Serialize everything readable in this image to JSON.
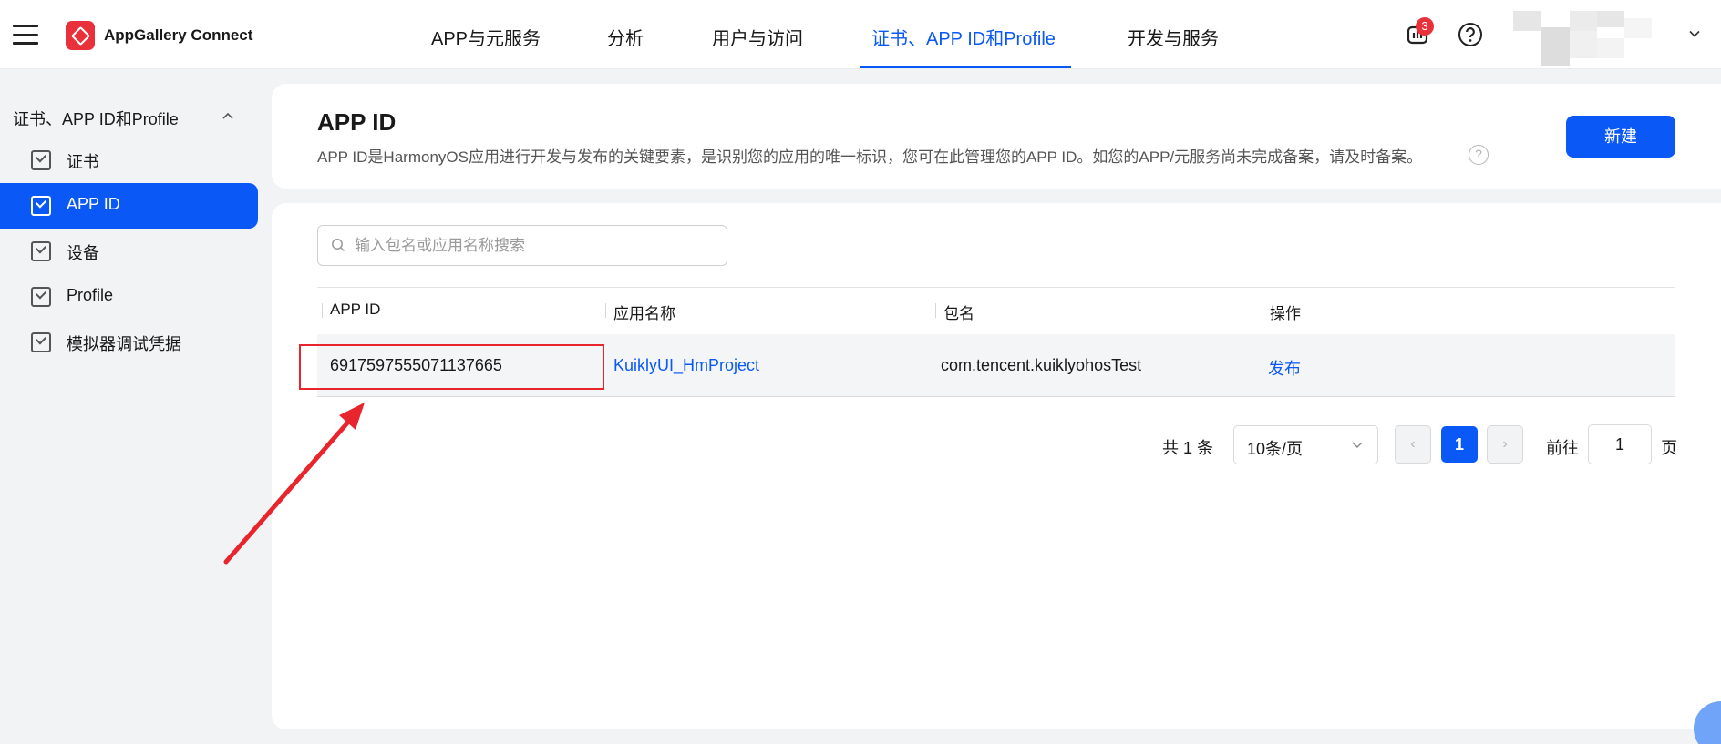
{
  "header": {
    "brand": "AppGallery Connect",
    "nav": [
      "APP与元服务",
      "分析",
      "用户与访问",
      "证书、APP ID和Profile",
      "开发与服务"
    ],
    "active_nav": "证书、APP ID和Profile",
    "notification_count": "3",
    "accent_color": "#0a59f7",
    "badge_color": "#e8313a"
  },
  "sidebar": {
    "group_label": "证书、APP ID和Profile",
    "items": [
      {
        "label": "证书"
      },
      {
        "label": "APP ID"
      },
      {
        "label": "设备"
      },
      {
        "label": "Profile"
      },
      {
        "label": "模拟器调试凭据"
      }
    ],
    "active_item": "APP ID"
  },
  "page": {
    "title": "APP ID",
    "description": "APP ID是HarmonyOS应用进行开发与发布的关键要素，是识别您的应用的唯一标识，您可在此管理您的APP ID。如您的APP/元服务尚未完成备案，请及时备案。",
    "help_glyph": "?",
    "new_button": "新建"
  },
  "search": {
    "placeholder": "输入包名或应用名称搜索",
    "value": ""
  },
  "table": {
    "columns": [
      "APP ID",
      "应用名称",
      "包名",
      "操作"
    ],
    "rows": [
      {
        "app_id": "6917597555071137665",
        "app_name": "KuiklyUI_HmProject",
        "package": "com.tencent.kuiklyohosTest",
        "action": "发布"
      }
    ]
  },
  "pagination": {
    "total": "共 1 条",
    "page_size": "10条/页",
    "prev_glyph": "‹",
    "next_glyph": "›",
    "current": "1",
    "goto_label": "前往",
    "goto_value": "1",
    "page_label": "页"
  },
  "annotation": {
    "highlight_color": "#e8252c"
  }
}
